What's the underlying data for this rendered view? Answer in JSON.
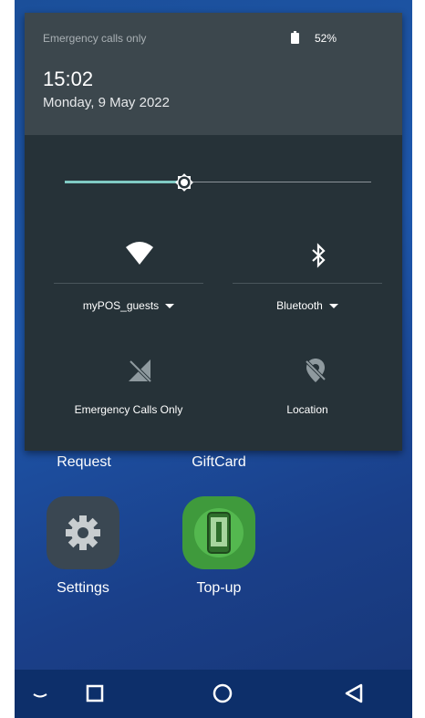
{
  "status_bar": {
    "carrier_text": "Emergency calls only",
    "battery_percent": "52%",
    "battery_icon": "battery-icon"
  },
  "clock": {
    "time": "15:02",
    "date": "Monday, 9 May 2022"
  },
  "brightness": {
    "level": 0.39,
    "icon": "brightness-icon"
  },
  "tiles": [
    {
      "label": "myPOS_guests",
      "icon": "wifi-icon",
      "has_dropdown": true
    },
    {
      "label": "Bluetooth",
      "icon": "bluetooth-icon",
      "has_dropdown": true
    },
    {
      "label": "Emergency Calls Only",
      "icon": "no-signal-icon",
      "has_dropdown": false
    },
    {
      "label": "Location",
      "icon": "location-off-icon",
      "has_dropdown": false
    }
  ],
  "home_apps": [
    {
      "label": "Request",
      "icon": null
    },
    {
      "label": "GiftCard",
      "icon": null
    },
    {
      "label": "Settings",
      "icon": "settings-gear-icon"
    },
    {
      "label": "Top-up",
      "icon": "topup-phone-icon"
    }
  ],
  "nav_bar": {
    "buttons": [
      "collapse-icon",
      "recents-icon",
      "home-icon",
      "back-icon"
    ]
  },
  "colors": {
    "panel_bg": "#263238",
    "header_bg": "#3c474d",
    "accent": "#80cbc4",
    "wallpaper": "#1e58ad",
    "navbar_bg": "#0d2f6a"
  }
}
